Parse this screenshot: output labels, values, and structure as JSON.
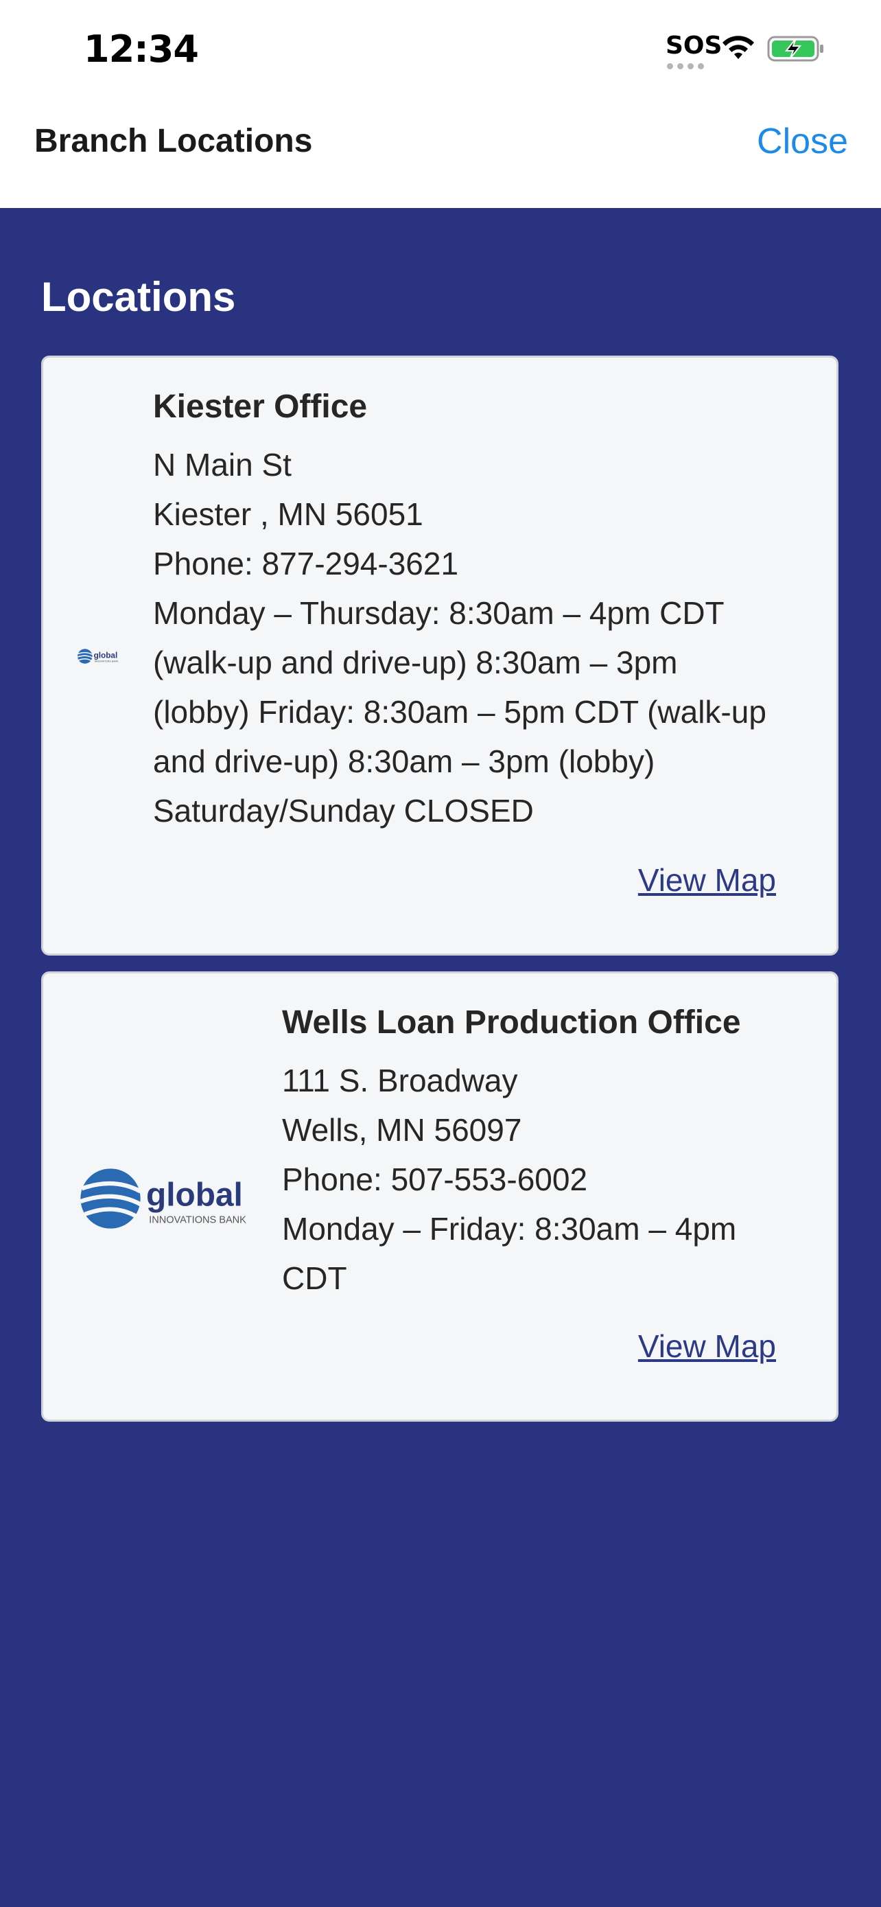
{
  "status_bar": {
    "time": "12:34",
    "sos": "SOS",
    "icons": [
      "wifi-icon",
      "battery-charging-icon"
    ]
  },
  "header": {
    "title": "Branch Locations",
    "close_label": "Close"
  },
  "main": {
    "section_title": "Locations",
    "locations": [
      {
        "name": "Kiester Office",
        "address": "N Main St",
        "city_state_zip": "Kiester , MN 56051",
        "phone": "Phone: 877-294-3621",
        "hours_lines": [
          "Monday – Thursday: 8:30am – 4pm CDT",
          "(walk-up and drive-up) 8:30am – 3pm",
          "(lobby) Friday: 8:30am – 5pm CDT (walk-up",
          "and drive-up) 8:30am – 3pm (lobby)",
          "Saturday/Sunday CLOSED"
        ],
        "map_label": "View Map",
        "logo": {
          "word": "global",
          "sub": "INNOVATIONS BANK"
        }
      },
      {
        "name": "Wells Loan Production Office",
        "address": "111 S. Broadway",
        "city_state_zip": "Wells, MN 56097",
        "phone": "Phone: 507-553-6002",
        "hours_lines": [
          "Monday – Friday: 8:30am – 4pm",
          "CDT"
        ],
        "map_label": "View Map",
        "logo": {
          "word": "global",
          "sub": "INNOVATIONS BANK"
        }
      }
    ]
  },
  "colors": {
    "background": "#29337f",
    "card": "#f5f6f8",
    "link": "#2c3a86",
    "close": "#1b8ae8",
    "logo_blue": "#2a6ab3",
    "logo_navy": "#2b3a78"
  }
}
